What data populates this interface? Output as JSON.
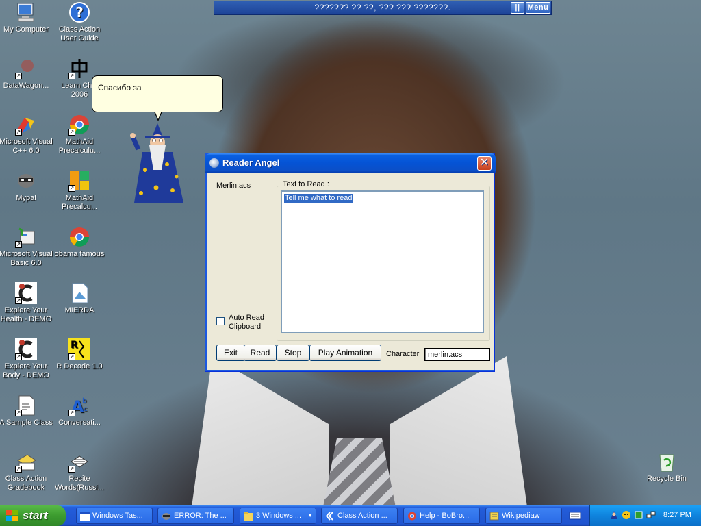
{
  "desktop": {
    "icons": [
      {
        "label": "My Computer",
        "icon": "my-computer-icon"
      },
      {
        "label": "Class Action User Guide",
        "icon": "help-icon"
      },
      {
        "label": "DataWagon...",
        "icon": "datawagon-icon"
      },
      {
        "label": "Learn Chin 2006",
        "icon": "chinese-character-icon"
      },
      {
        "label": "Microsoft Visual C++ 6.0",
        "icon": "visual-cpp-icon"
      },
      {
        "label": "MathAid Precalculu...",
        "icon": "chrome-shortcut-icon"
      },
      {
        "label": "Mypal",
        "icon": "raccoon-icon"
      },
      {
        "label": "MathAid Precalcu...",
        "icon": "mathaid-icon"
      },
      {
        "label": "Microsoft Visual Basic 6.0",
        "icon": "visual-basic-icon"
      },
      {
        "label": "obama famous",
        "icon": "chrome-icon"
      },
      {
        "label": "Explore Your Health - DEMO",
        "icon": "explore-health-icon"
      },
      {
        "label": "MIERDA",
        "icon": "image-file-icon"
      },
      {
        "label": "Explore Your Body - DEMO",
        "icon": "explore-body-icon"
      },
      {
        "label": "R Decode 1.0",
        "icon": "rdecode-icon"
      },
      {
        "label": "A Sample Class",
        "icon": "sample-class-icon"
      },
      {
        "label": "Conversati...",
        "icon": "conversation-icon"
      },
      {
        "label": "Class Action Gradebook",
        "icon": "gradebook-icon"
      },
      {
        "label": "Recite Words(Russi...",
        "icon": "recite-words-icon"
      },
      {
        "label": "Recycle Bin",
        "icon": "recycle-bin-icon"
      }
    ]
  },
  "banner": {
    "text": "??????? ?? ??, ??? ??? ???????.",
    "pause_label": "||",
    "menu_label": "Menu"
  },
  "balloon": {
    "text": "Спасибо за"
  },
  "window": {
    "title": "Reader Angel",
    "close_label": "✕",
    "agent_file": "Merlin.acs",
    "text_group_label": "Text to Read :",
    "text_value": "Tell me what to read",
    "auto_read_label": "Auto Read Clipboard",
    "auto_read_checked": false,
    "buttons": {
      "exit": "Exit",
      "read": "Read",
      "stop": "Stop",
      "play": "Play Animation"
    },
    "character_label": "Character",
    "character_value": "merlin.acs"
  },
  "taskbar": {
    "start_label": "start",
    "buttons": [
      {
        "label": "Windows Tas..."
      },
      {
        "label": "ERROR: The ..."
      },
      {
        "label": "3 Windows ..."
      },
      {
        "label": "Class Action ..."
      },
      {
        "label": "Help - BoBro..."
      },
      {
        "label": "Wikipediaw"
      }
    ],
    "clock": "8:27 PM"
  },
  "colors": {
    "taskbar_blue": "#245edb",
    "start_green": "#3c9b2f",
    "title_blue": "#0553d5",
    "balloon_yellow": "#ffffe1",
    "selection_blue": "#316ac5"
  }
}
